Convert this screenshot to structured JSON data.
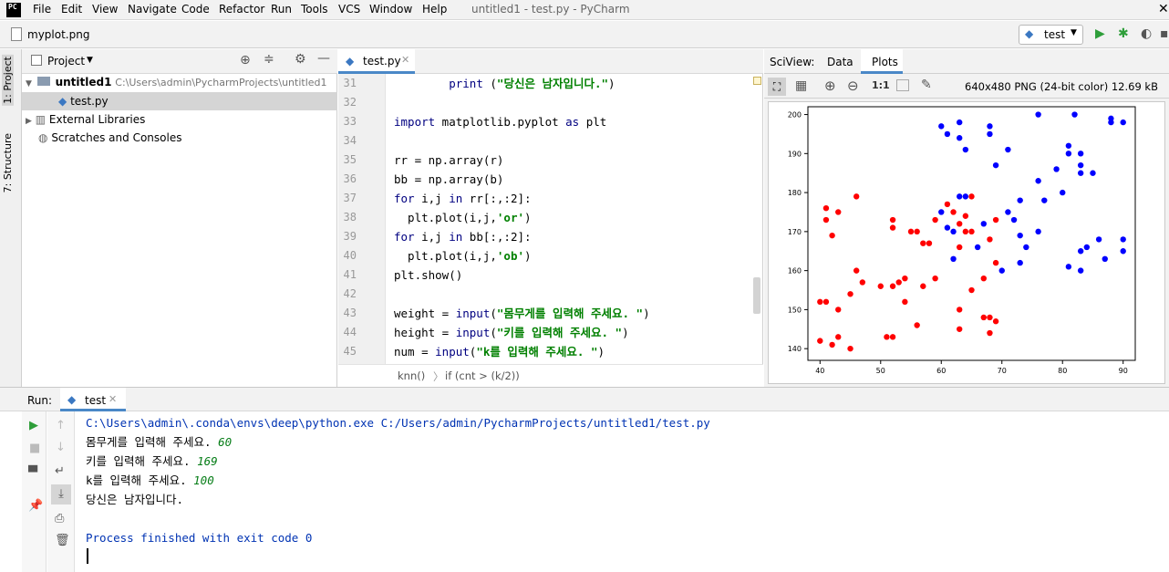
{
  "app": {
    "logo": "PC",
    "title": "untitled1 - test.py - PyCharm"
  },
  "menu": [
    "File",
    "Edit",
    "View",
    "Navigate",
    "Code",
    "Refactor",
    "Run",
    "Tools",
    "VCS",
    "Window",
    "Help"
  ],
  "navbar": {
    "file": "myplot.png",
    "run_config": "test"
  },
  "left_tabs": {
    "project": "1: Project",
    "structure": "7: Structure"
  },
  "project": {
    "header": "Project",
    "root": "untitled1",
    "root_path": "C:\\Users\\admin\\PycharmProjects\\untitled1",
    "file": "test.py",
    "ext_libs": "External Libraries",
    "scratches": "Scratches and Consoles"
  },
  "editor": {
    "tab": "test.py",
    "breadcrumb_func": "knn()",
    "breadcrumb_cond": "if (cnt > (k/2))",
    "lines": [
      {
        "n": "31",
        "parts": [
          {
            "t": "        "
          },
          {
            "t": "print",
            "c": "kw"
          },
          {
            "t": " ("
          },
          {
            "t": "\"당신은 남자입니다.\"",
            "c": "st"
          },
          {
            "t": ")"
          }
        ]
      },
      {
        "n": "32",
        "parts": []
      },
      {
        "n": "33",
        "parts": [
          {
            "t": "import",
            "c": "kw"
          },
          {
            "t": " matplotlib.pyplot "
          },
          {
            "t": "as",
            "c": "kw"
          },
          {
            "t": " plt"
          }
        ]
      },
      {
        "n": "34",
        "parts": []
      },
      {
        "n": "35",
        "parts": [
          {
            "t": "rr = np.array(r)"
          }
        ]
      },
      {
        "n": "36",
        "parts": [
          {
            "t": "bb = np.array(b)"
          }
        ]
      },
      {
        "n": "37",
        "parts": [
          {
            "t": "for",
            "c": "kw"
          },
          {
            "t": " i,j "
          },
          {
            "t": "in",
            "c": "kw"
          },
          {
            "t": " rr[:,:2]:"
          }
        ]
      },
      {
        "n": "38",
        "parts": [
          {
            "t": "  plt.plot(i,j,"
          },
          {
            "t": "'or'",
            "c": "st"
          },
          {
            "t": ")"
          }
        ]
      },
      {
        "n": "39",
        "parts": [
          {
            "t": "for",
            "c": "kw"
          },
          {
            "t": " i,j "
          },
          {
            "t": "in",
            "c": "kw"
          },
          {
            "t": " bb[:,:2]:"
          }
        ]
      },
      {
        "n": "40",
        "parts": [
          {
            "t": "  plt.plot(i,j,"
          },
          {
            "t": "'ob'",
            "c": "st"
          },
          {
            "t": ")"
          }
        ]
      },
      {
        "n": "41",
        "parts": [
          {
            "t": "plt.show()"
          }
        ]
      },
      {
        "n": "42",
        "parts": []
      },
      {
        "n": "43",
        "parts": [
          {
            "t": "weight = "
          },
          {
            "t": "input",
            "c": "kw"
          },
          {
            "t": "("
          },
          {
            "t": "\"몸무게를 입력해 주세요. \"",
            "c": "st"
          },
          {
            "t": ")"
          }
        ]
      },
      {
        "n": "44",
        "parts": [
          {
            "t": "height = "
          },
          {
            "t": "input",
            "c": "kw"
          },
          {
            "t": "("
          },
          {
            "t": "\"키를 입력해 주세요. \"",
            "c": "st"
          },
          {
            "t": ")"
          }
        ]
      },
      {
        "n": "45",
        "parts": [
          {
            "t": "num = "
          },
          {
            "t": "input",
            "c": "kw"
          },
          {
            "t": "("
          },
          {
            "t": "\"k를 입력해 주세요. \"",
            "c": "st"
          },
          {
            "t": ")"
          }
        ]
      }
    ]
  },
  "sciview": {
    "label": "SciView:",
    "tab_data": "Data",
    "tab_plots": "Plots",
    "info": "640x480 PNG (24-bit color) 12.69 kB",
    "zoom_actual": "1:1"
  },
  "chart_data": {
    "type": "scatter",
    "xlim": [
      38,
      92
    ],
    "ylim": [
      137,
      202
    ],
    "xticks": [
      40,
      50,
      60,
      70,
      80,
      90
    ],
    "yticks": [
      140,
      150,
      160,
      170,
      180,
      190,
      200
    ],
    "series": [
      {
        "color": "#ff0000",
        "points": [
          [
            40,
            142
          ],
          [
            40,
            152
          ],
          [
            41,
            176
          ],
          [
            41,
            173
          ],
          [
            41,
            152
          ],
          [
            42,
            169
          ],
          [
            42,
            141
          ],
          [
            43,
            175
          ],
          [
            43,
            150
          ],
          [
            43,
            143
          ],
          [
            45,
            140
          ],
          [
            45,
            154
          ],
          [
            46,
            179
          ],
          [
            46,
            160
          ],
          [
            47,
            157
          ],
          [
            50,
            156
          ],
          [
            51,
            143
          ],
          [
            52,
            173
          ],
          [
            52,
            171
          ],
          [
            52,
            156
          ],
          [
            52,
            143
          ],
          [
            53,
            157
          ],
          [
            54,
            158
          ],
          [
            54,
            152
          ],
          [
            55,
            170
          ],
          [
            56,
            170
          ],
          [
            56,
            146
          ],
          [
            57,
            167
          ],
          [
            57,
            156
          ],
          [
            58,
            167
          ],
          [
            59,
            158
          ],
          [
            59,
            173
          ],
          [
            61,
            177
          ],
          [
            62,
            175
          ],
          [
            63,
            166
          ],
          [
            63,
            172
          ],
          [
            63,
            150
          ],
          [
            63,
            145
          ],
          [
            64,
            174
          ],
          [
            64,
            170
          ],
          [
            65,
            179
          ],
          [
            65,
            170
          ],
          [
            65,
            155
          ],
          [
            67,
            158
          ],
          [
            67,
            148
          ],
          [
            68,
            148
          ],
          [
            68,
            144
          ],
          [
            68,
            168
          ],
          [
            69,
            162
          ],
          [
            69,
            147
          ],
          [
            69,
            173
          ]
        ]
      },
      {
        "color": "#0000ff",
        "points": [
          [
            60,
            197
          ],
          [
            60,
            175
          ],
          [
            61,
            195
          ],
          [
            61,
            171
          ],
          [
            62,
            170
          ],
          [
            62,
            163
          ],
          [
            63,
            198
          ],
          [
            63,
            194
          ],
          [
            63,
            179
          ],
          [
            64,
            191
          ],
          [
            64,
            179
          ],
          [
            66,
            166
          ],
          [
            67,
            172
          ],
          [
            68,
            197
          ],
          [
            68,
            195
          ],
          [
            69,
            187
          ],
          [
            70,
            160
          ],
          [
            71,
            191
          ],
          [
            71,
            175
          ],
          [
            72,
            173
          ],
          [
            73,
            178
          ],
          [
            73,
            169
          ],
          [
            73,
            162
          ],
          [
            74,
            166
          ],
          [
            76,
            200
          ],
          [
            76,
            183
          ],
          [
            76,
            170
          ],
          [
            77,
            178
          ],
          [
            79,
            186
          ],
          [
            80,
            180
          ],
          [
            81,
            192
          ],
          [
            81,
            190
          ],
          [
            81,
            161
          ],
          [
            82,
            200
          ],
          [
            83,
            190
          ],
          [
            83,
            187
          ],
          [
            83,
            185
          ],
          [
            83,
            165
          ],
          [
            83,
            160
          ],
          [
            84,
            166
          ],
          [
            85,
            185
          ],
          [
            86,
            168
          ],
          [
            87,
            163
          ],
          [
            88,
            199
          ],
          [
            88,
            198
          ],
          [
            90,
            198
          ],
          [
            90,
            168
          ],
          [
            90,
            165
          ]
        ]
      }
    ]
  },
  "run": {
    "label": "Run:",
    "tab": "test",
    "lines": [
      {
        "parts": [
          {
            "t": "C:\\Users\\admin\\.conda\\envs\\deep\\python.exe C:/Users/admin/PycharmProjects/untitled1/test.py",
            "c": "blue"
          }
        ]
      },
      {
        "parts": [
          {
            "t": "몸무게를 입력해 주세요. "
          },
          {
            "t": "60",
            "c": "green"
          }
        ]
      },
      {
        "parts": [
          {
            "t": "키를 입력해 주세요. "
          },
          {
            "t": "169",
            "c": "green"
          }
        ]
      },
      {
        "parts": [
          {
            "t": "k를 입력해 주세요. "
          },
          {
            "t": "100",
            "c": "green"
          }
        ]
      },
      {
        "parts": [
          {
            "t": "당신은 남자입니다."
          }
        ]
      },
      {
        "parts": []
      },
      {
        "parts": [
          {
            "t": "Process finished with exit code 0",
            "c": "blue"
          }
        ]
      }
    ]
  }
}
